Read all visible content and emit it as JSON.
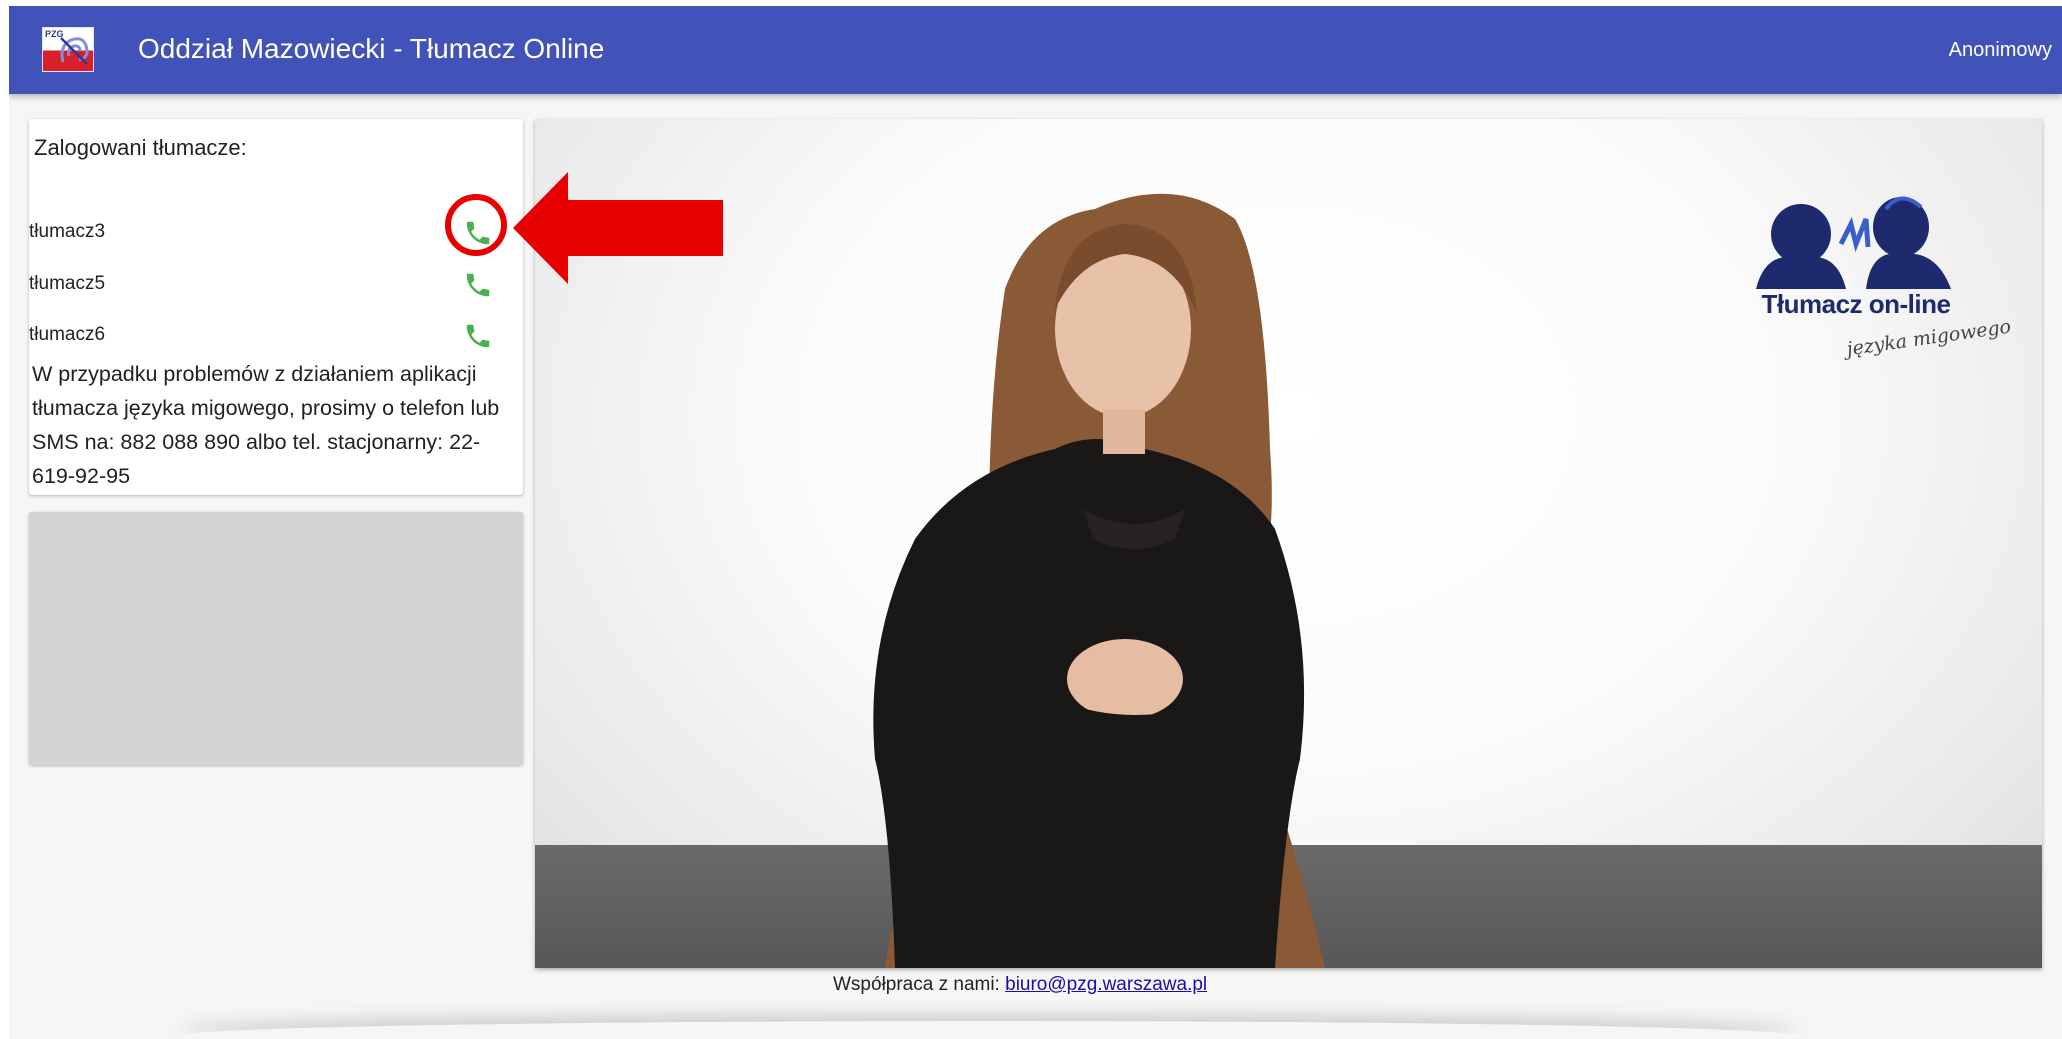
{
  "header": {
    "logo_text": "PZG",
    "title": "Oddział Mazowiecki - Tłumacz Online",
    "user": "Anonimowy"
  },
  "interpreters_panel": {
    "title": "Zalogowani tłumacze:",
    "interpreters": [
      {
        "name": "tłumacz3",
        "call_icon": "phone-icon"
      },
      {
        "name": "tłumacz5",
        "call_icon": "phone-icon"
      },
      {
        "name": "tłumacz6",
        "call_icon": "phone-icon"
      }
    ],
    "help_text": "W przypadku problemów z działaniem aplikacji tłumacza języka migowego, prosimy o telefon lub SMS na: 882 088 890 albo tel. stacjonarny: 22-619-92-95"
  },
  "video": {
    "logo_title": "Tłumacz on-line",
    "logo_subtitle": "języka migowego"
  },
  "footer": {
    "label": "Współpraca z nami: ",
    "email": "biuro@pzg.warszawa.pl"
  },
  "colors": {
    "appbar": "#4152b9",
    "call_icon": "#4caf50",
    "annotation": "#e80000",
    "link": "#1a0dab"
  }
}
